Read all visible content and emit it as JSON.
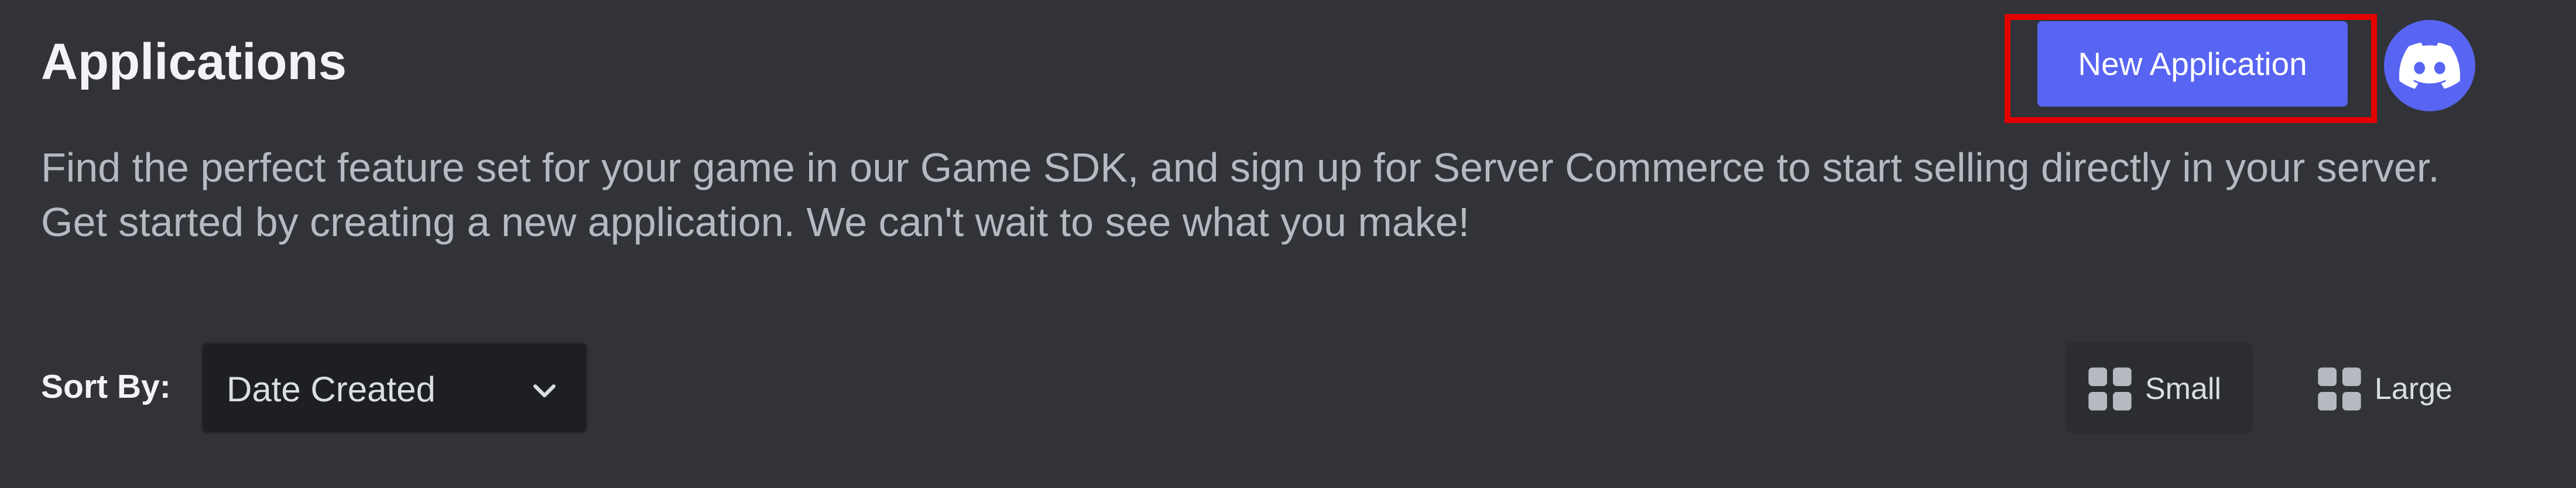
{
  "header": {
    "title": "Applications",
    "new_app_label": "New Application",
    "avatar_icon": "discord-logo-icon"
  },
  "description": "Find the perfect feature set for your game in our Game SDK, and sign up for Server Commerce to start selling directly in your server. Get started by creating a new application. We can't wait to see what you make!",
  "sort": {
    "label": "Sort By:",
    "selected": "Date Created",
    "icon": "chevron-down-icon"
  },
  "view_toggle": {
    "small_label": "Small",
    "large_label": "Large",
    "icon": "grid-icon",
    "active": "Small"
  },
  "colors": {
    "background": "#313338",
    "brand": "#5865f2",
    "highlight": "#e50000",
    "muted_text": "#b5bac1"
  }
}
